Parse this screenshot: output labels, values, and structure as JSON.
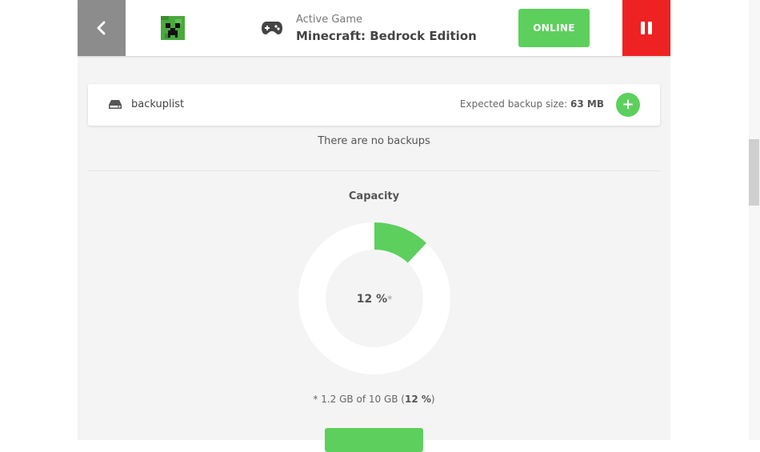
{
  "header": {
    "active_label": "Active Game",
    "game_name": "Minecraft: Bedrock Edition",
    "status_label": "ONLINE",
    "status_color": "#5dcf5d",
    "stop_color": "#ee2222"
  },
  "backups": {
    "list_name": "backuplist",
    "expected_prefix": "Expected backup size:",
    "expected_value": "63 MB",
    "add_icon": "+",
    "empty_text": "There are no backups"
  },
  "capacity": {
    "title": "Capacity",
    "percent": 12,
    "percent_label": "12 %",
    "asterisk": "*",
    "note_prefix": "* 1.2 GB of 10 GB (",
    "note_percent": "12 %",
    "note_suffix": ")",
    "fill_color": "#5dcf5d"
  },
  "icons": {
    "back": "chevron-left-icon",
    "game": "creeper-icon",
    "controller": "gamepad-icon",
    "stop": "pause-icon",
    "drive": "hard-drive-icon",
    "add": "plus-icon"
  }
}
